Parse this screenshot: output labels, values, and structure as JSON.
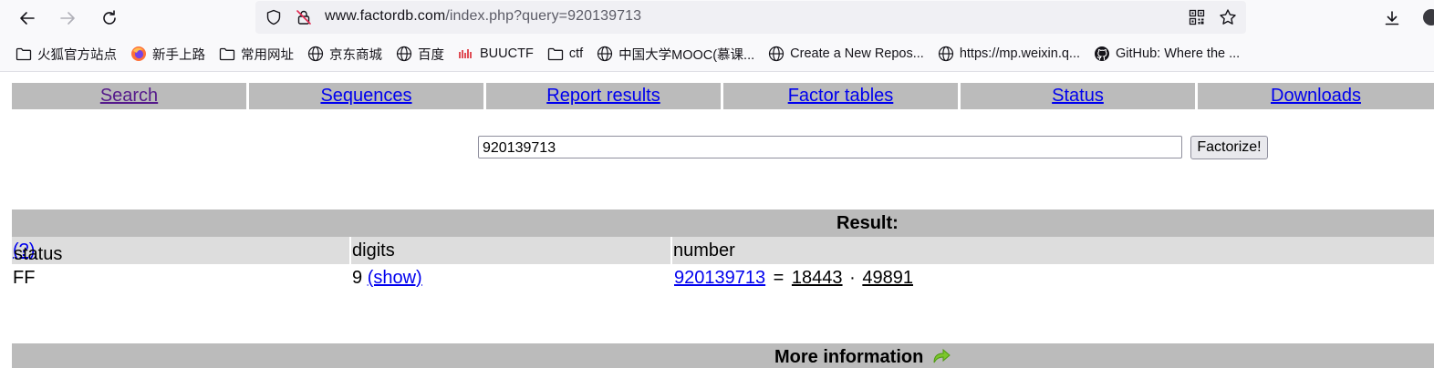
{
  "browser": {
    "url_host": "www.factordb.com",
    "url_path": "/index.php?query=920139713",
    "bookmarks": [
      {
        "label": "火狐官方站点",
        "icon": "folder-icon"
      },
      {
        "label": "新手上路",
        "icon": "firefox-icon"
      },
      {
        "label": "常用网址",
        "icon": "folder-icon"
      },
      {
        "label": "京东商城",
        "icon": "globe-icon"
      },
      {
        "label": "百度",
        "icon": "globe-icon"
      },
      {
        "label": "BUUCTF",
        "icon": "buuctf-icon"
      },
      {
        "label": "ctf",
        "icon": "folder-icon"
      },
      {
        "label": "中国大学MOOC(慕课...",
        "icon": "globe-icon"
      },
      {
        "label": "Create a New Repos...",
        "icon": "globe-icon"
      },
      {
        "label": "https://mp.weixin.q...",
        "icon": "globe-icon"
      },
      {
        "label": "GitHub: Where the ...",
        "icon": "github-icon"
      }
    ]
  },
  "menu": [
    {
      "label": "Search",
      "visited": true
    },
    {
      "label": "Sequences"
    },
    {
      "label": "Report results"
    },
    {
      "label": "Factor tables"
    },
    {
      "label": "Status"
    },
    {
      "label": "Downloads"
    }
  ],
  "search": {
    "value": "920139713",
    "button_label": "Factorize!"
  },
  "result": {
    "title": "Result:",
    "columns": {
      "status": "status",
      "status_help": "(?)",
      "digits": "digits",
      "number": "number"
    },
    "row": {
      "status": "FF",
      "digits": "9",
      "show_link": "(show)",
      "number": "920139713",
      "equals": "=",
      "factor1": "18443",
      "dot": "·",
      "factor2": "49891"
    }
  },
  "more": {
    "title": "More information"
  }
}
